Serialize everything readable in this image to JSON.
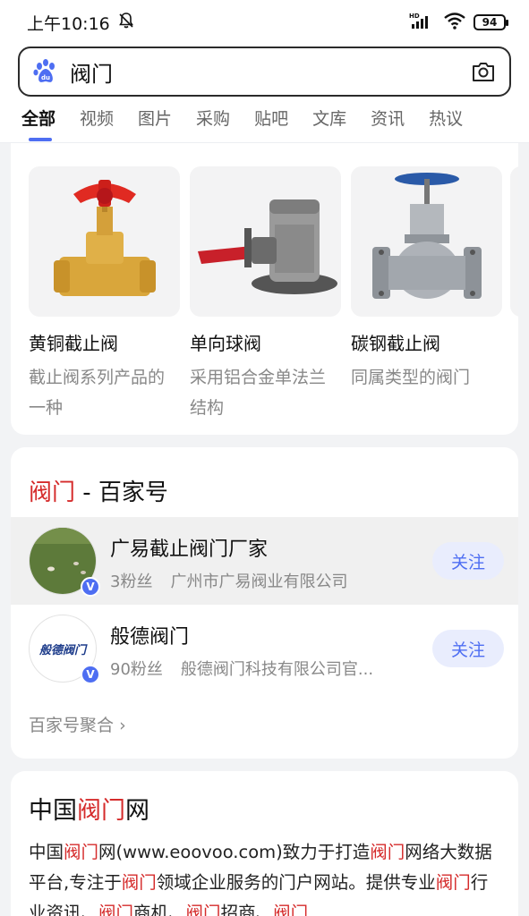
{
  "status_bar": {
    "time": "上午10:16",
    "network": "HD",
    "battery": "94"
  },
  "search": {
    "query": "阀门"
  },
  "tabs": [
    {
      "label": "全部",
      "active": true
    },
    {
      "label": "视频"
    },
    {
      "label": "图片"
    },
    {
      "label": "采购"
    },
    {
      "label": "贴吧"
    },
    {
      "label": "文库"
    },
    {
      "label": "资讯"
    },
    {
      "label": "热议"
    }
  ],
  "products": [
    {
      "name": "黄铜截止阀",
      "desc": "截止阀系列产品的一种"
    },
    {
      "name": "单向球阀",
      "desc": "采用铝合金单法兰结构"
    },
    {
      "name": "碳钢截止阀",
      "desc": "同属类型的阀门"
    }
  ],
  "baijiahao": {
    "title_highlight": "阀门",
    "title_rest": " - 百家号",
    "accounts": [
      {
        "name": "广易截止阀门厂家",
        "fans": "3粉丝",
        "company": "广州市广易阀业有限公司",
        "follow": "关注"
      },
      {
        "name": "般德阀门",
        "fans": "90粉丝",
        "company": "般德阀门科技有限公司官...",
        "follow": "关注",
        "logo_text": "般德阀门"
      }
    ],
    "more": "百家号聚合"
  },
  "site": {
    "title_pre": "中国",
    "title_hl": "阀门",
    "title_post": "网",
    "desc_segments": [
      {
        "t": "中国"
      },
      {
        "t": "阀门",
        "hl": true
      },
      {
        "t": "网(www.eoovoo.com)致力于打造"
      },
      {
        "t": "阀门",
        "hl": true
      },
      {
        "t": "网络大数据平台,专注于"
      },
      {
        "t": "阀门",
        "hl": true
      },
      {
        "t": "领域企业服务的门户网站。提供专业"
      },
      {
        "t": "阀门",
        "hl": true
      },
      {
        "t": "行业资讯、"
      },
      {
        "t": "阀门",
        "hl": true
      },
      {
        "t": "商机、"
      },
      {
        "t": "阀门",
        "hl": true
      },
      {
        "t": "招商、"
      },
      {
        "t": "阀门",
        "hl": true
      }
    ]
  },
  "colors": {
    "accent": "#4e6ef2",
    "highlight": "#d52b2b"
  }
}
